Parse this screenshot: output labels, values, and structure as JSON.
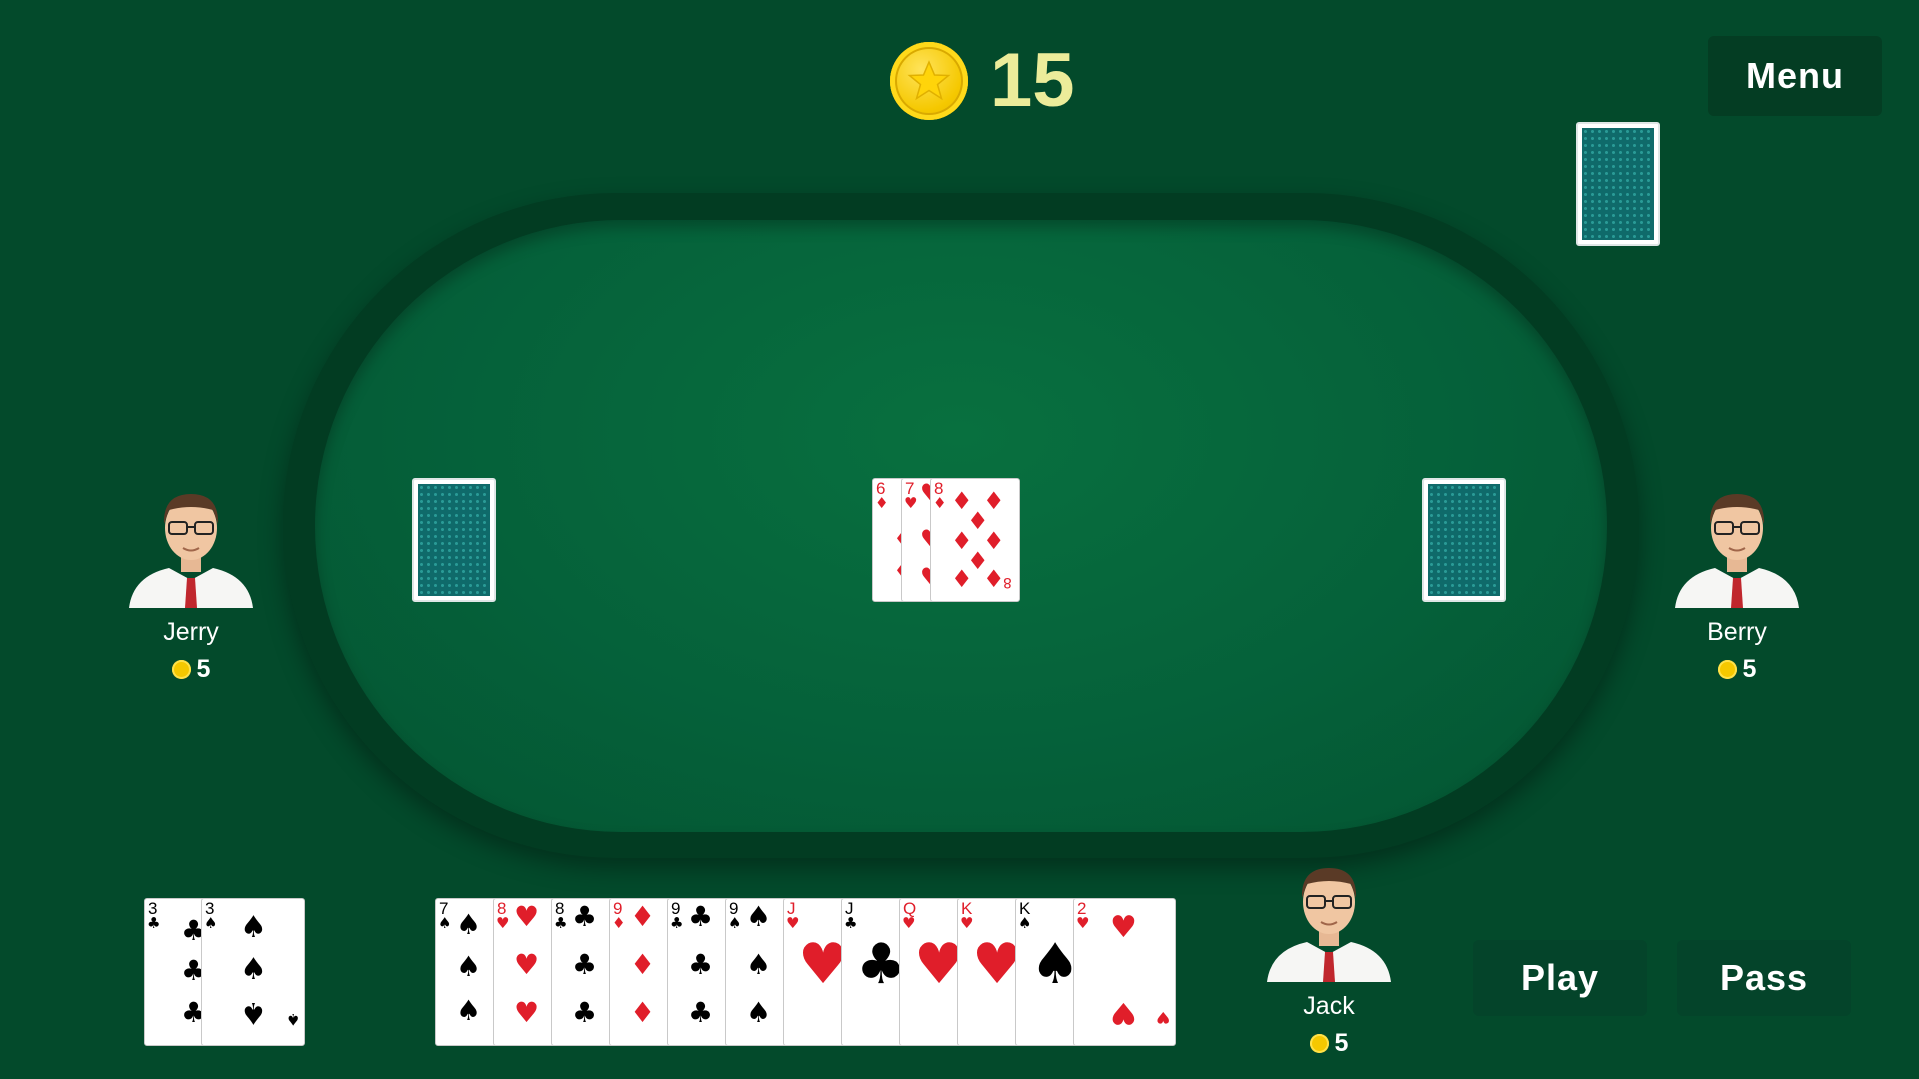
{
  "pot": {
    "value": "15",
    "icon": "coin-star-icon"
  },
  "menu": {
    "label": "Menu"
  },
  "players": {
    "left": {
      "name": "Jerry",
      "coins": "5"
    },
    "right": {
      "name": "Berry",
      "coins": "5"
    },
    "self": {
      "name": "Jack",
      "coins": "5"
    }
  },
  "played_cards": [
    {
      "rank": "6",
      "suit": "♦"
    },
    {
      "rank": "7",
      "suit": "♥"
    },
    {
      "rank": "8",
      "suit": "♦"
    }
  ],
  "pile_cards": [
    {
      "rank": "3",
      "suit": "♣"
    },
    {
      "rank": "3",
      "suit": "♠"
    }
  ],
  "hand": [
    {
      "rank": "7",
      "suit": "♠"
    },
    {
      "rank": "8",
      "suit": "♥"
    },
    {
      "rank": "8",
      "suit": "♣"
    },
    {
      "rank": "9",
      "suit": "♦"
    },
    {
      "rank": "9",
      "suit": "♣"
    },
    {
      "rank": "9",
      "suit": "♠"
    },
    {
      "rank": "J",
      "suit": "♥"
    },
    {
      "rank": "J",
      "suit": "♣"
    },
    {
      "rank": "Q",
      "suit": "♥"
    },
    {
      "rank": "K",
      "suit": "♥"
    },
    {
      "rank": "K",
      "suit": "♠"
    },
    {
      "rank": "2",
      "suit": "♥"
    }
  ],
  "actions": {
    "play": "Play",
    "pass": "Pass"
  },
  "colors": {
    "background": "#034a2b",
    "felt": "#05613a",
    "card_back": "#0f6a6a",
    "coin": "#f5c800"
  }
}
